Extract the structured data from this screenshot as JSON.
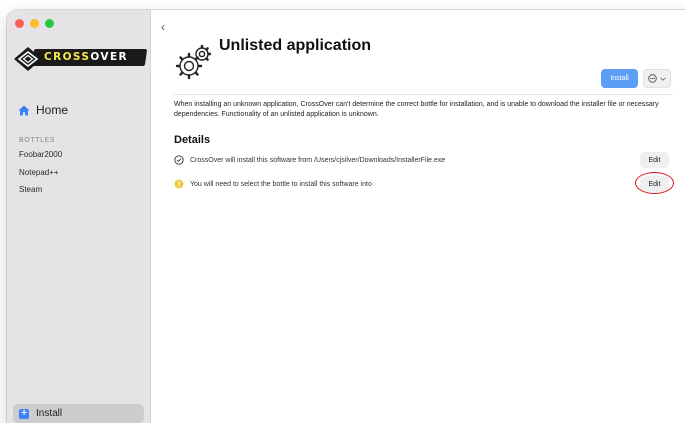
{
  "window": {
    "traffic_lights": [
      "close",
      "minimize",
      "zoom"
    ]
  },
  "sidebar": {
    "logo": {
      "text_part1": "CROSS",
      "text_part2": "OVER"
    },
    "home_label": "Home",
    "section_title": "BOTTLES",
    "bottles": [
      "Foobar2000",
      "Notepad++",
      "Steam"
    ],
    "install_label": "Install"
  },
  "main": {
    "back_glyph": "‹",
    "title": "Unlisted application",
    "install_button": "Install",
    "more_glyph": "⋯",
    "description": "When installing an unknown application, CrossOver can't determine the correct bottle for installation, and is unable to download the installer file or necessary dependencies. Functionality of an unlisted application is unknown.",
    "details_title": "Details",
    "details": [
      {
        "icon": "check-circle-icon",
        "text": "CrossOver will install this software from /Users/cjsilver/Downloads/InstallerFile.exe",
        "edit_label": "Edit"
      },
      {
        "icon": "warning-icon",
        "text": "You will need to select the bottle to install this software into",
        "edit_label": "Edit"
      }
    ]
  },
  "colors": {
    "sidebar_bg": "#e6e3e6",
    "accent_blue": "#5c9ef5",
    "warning_yellow": "#f2c744",
    "highlight_red": "#d9131a"
  }
}
